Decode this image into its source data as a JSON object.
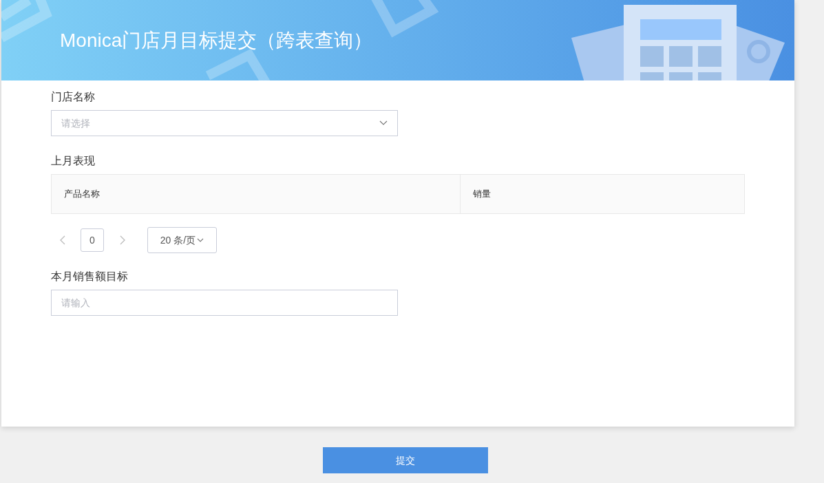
{
  "header": {
    "title": "Monica门店月目标提交（跨表查询）"
  },
  "store_field": {
    "label": "门店名称",
    "placeholder": "请选择"
  },
  "last_month": {
    "label": "上月表现",
    "columns": [
      "产品名称",
      "销量"
    ]
  },
  "pagination": {
    "page": "0",
    "page_size": "20 条/页"
  },
  "target_field": {
    "label": "本月销售额目标",
    "placeholder": "请输入"
  },
  "submit_button": "提交"
}
